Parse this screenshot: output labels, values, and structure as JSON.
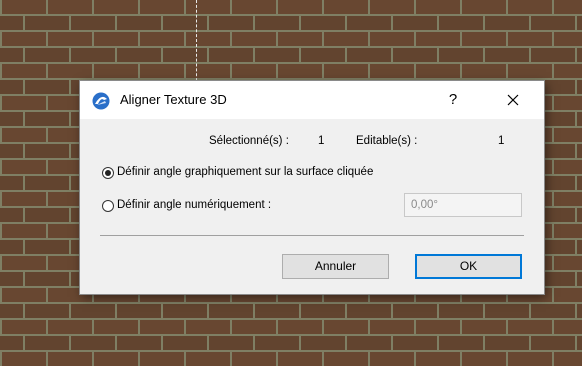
{
  "dialog": {
    "title": "Aligner Texture 3D",
    "help_label": "?",
    "selected_label": "Sélectionné(s) :",
    "selected_count": "1",
    "editable_label": "Editable(s) :",
    "editable_count": "1",
    "option_graphic_label": "Définir angle graphiquement sur la surface cliquée",
    "option_numeric_label": "Définir angle numériquement :",
    "selected_option": "graphic",
    "angle_value": "0,00°",
    "cancel_label": "Annuler",
    "ok_label": "OK"
  },
  "icons": {
    "app": "archicad-app-icon",
    "close": "close-icon"
  },
  "colors": {
    "brick": "#6b4a33",
    "mortar": "#8c8a6e",
    "dialog_bg": "#f0f0f0",
    "accent": "#0078d7"
  }
}
